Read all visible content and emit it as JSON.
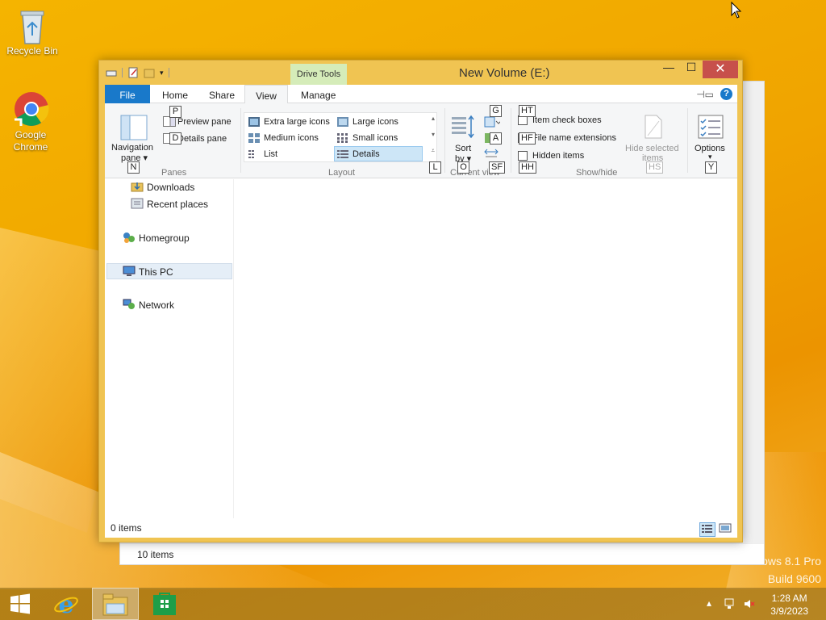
{
  "desktop": {
    "icons": [
      {
        "label": "Recycle Bin"
      },
      {
        "label": "Google Chrome"
      }
    ],
    "watermark": [
      "ows 8.1 Pro",
      "Build 9600"
    ]
  },
  "background_window": {
    "status_count": "10 items"
  },
  "window": {
    "title": "New Volume (E:)",
    "context_tab": "Drive Tools",
    "controls": {
      "minimize": "—",
      "maximize": "☐",
      "close": "✕"
    },
    "tabs": {
      "file": "File",
      "home": "Home",
      "share": "Share",
      "view": "View",
      "manage": "Manage"
    },
    "ribbon": {
      "panes": {
        "navigation_pane": [
          "Navigation",
          "pane ▾"
        ],
        "preview_pane": "Preview pane",
        "details_pane": "Details pane",
        "group": "Panes"
      },
      "layout": {
        "items": [
          "Extra large icons",
          "Large icons",
          "Medium icons",
          "Small icons",
          "List",
          "Details"
        ],
        "selected": "Details",
        "group": "Layout"
      },
      "current_view": {
        "sort_by": [
          "Sort",
          "by ▾"
        ],
        "group": "Current view"
      },
      "show_hide": {
        "item_check_boxes": "Item check boxes",
        "file_name_extensions": "File name extensions",
        "hidden_items": "Hidden items",
        "hide_selected": [
          "Hide selected",
          "items"
        ],
        "group": "Show/hide"
      },
      "options": [
        "Options",
        "▾"
      ]
    },
    "keytips": {
      "p": "P",
      "d": "D",
      "n": "N",
      "l": "L",
      "g": "G",
      "a": "A",
      "o": "O",
      "sf": "SF",
      "ht": "HT",
      "hf": "HF",
      "hh": "HH",
      "hs": "HS",
      "y": "Y"
    },
    "nav": {
      "items": [
        "Downloads",
        "Recent places",
        "Homegroup",
        "This PC",
        "Network"
      ],
      "selected": "This PC"
    },
    "status": {
      "count": "0 items"
    }
  },
  "taskbar": {
    "clock_time": "1:28 AM",
    "clock_date": "3/9/2023"
  },
  "colors": {
    "accent": "#1979ca",
    "title_bar": "#f0c452",
    "close": "#c7504b",
    "context_tab": "#d5ecb9"
  }
}
